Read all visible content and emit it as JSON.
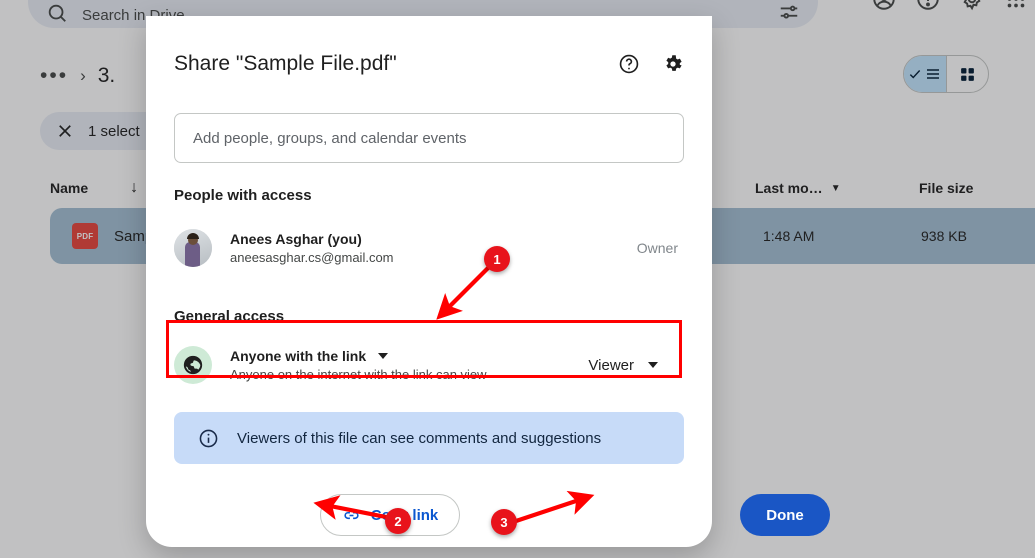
{
  "background": {
    "search": {
      "placeholder": "Search in Drive",
      "icon": "search-icon",
      "filter_icon": "tune-icon"
    },
    "header_icons": [
      "account-icon",
      "help-icon",
      "settings-gear-icon",
      "apps-grid-icon"
    ],
    "breadcrumb": {
      "overflow": "•••",
      "separator": "›",
      "current": "3."
    },
    "selection_chip": {
      "close": "✕",
      "label": "1 select"
    },
    "view_toggle": {
      "list_label": "list-view",
      "grid_label": "grid-view",
      "active": "list-view"
    },
    "columns": {
      "name": "Name",
      "sort_arrow": "↓",
      "modified": "Last mo…",
      "modified_caret": "▼",
      "size": "File size"
    },
    "file_row": {
      "type_badge": "PDF",
      "name": "Samp",
      "modified": "1:48 AM",
      "size": "938 KB"
    }
  },
  "dialog": {
    "title": "Share \"Sample File.pdf\"",
    "help_icon": "help-circle-icon",
    "settings_icon": "gear-icon",
    "add_people": {
      "placeholder": "Add people, groups, and calendar events",
      "value": ""
    },
    "people_section": {
      "heading": "People with access"
    },
    "person": {
      "name": "Anees Asghar (you)",
      "email": "aneesasghar.cs@gmail.com",
      "role": "Owner",
      "avatar": "user-photo-avatar"
    },
    "general_section": {
      "heading": "General access",
      "icon": "globe-icon",
      "access_level": "Anyone with the link",
      "access_caret": "▼",
      "description": "Anyone on the internet with the link can view",
      "role": "Viewer",
      "role_caret": "▼"
    },
    "info_banner": {
      "icon": "info-icon",
      "text": "Viewers of this file can see comments and suggestions"
    },
    "copy_link_button": {
      "label": "Copy link",
      "icon": "link-icon"
    },
    "done_button": {
      "label": "Done"
    }
  },
  "annotations": {
    "markers": [
      {
        "id": "1",
        "label": "1"
      },
      {
        "id": "2",
        "label": "2"
      },
      {
        "id": "3",
        "label": "3"
      }
    ],
    "highlight_color": "#ff0000",
    "marker_color": "#e8131b"
  }
}
